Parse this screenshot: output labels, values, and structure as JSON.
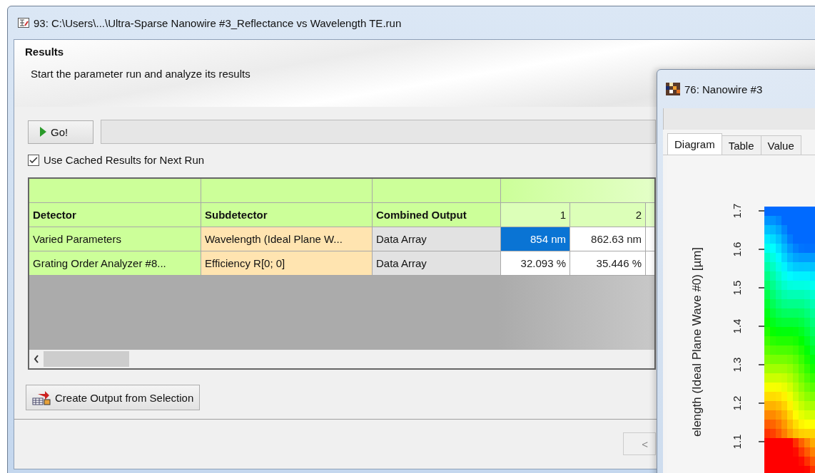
{
  "window": {
    "title": "93: C:\\Users\\...\\Ultra-Sparse Nanowire #3_Reflectance vs Wavelength TE.run"
  },
  "header": {
    "title": "Results",
    "subtitle": "Start the parameter run and analyze its results"
  },
  "go_button": {
    "label": "Go!"
  },
  "cache_checkbox": {
    "label": "Use Cached Results for Next Run",
    "checked": true
  },
  "table": {
    "columns": [
      "Detector",
      "Subdetector",
      "Combined Output",
      "1",
      "2"
    ],
    "rows": [
      {
        "detector": "Varied Parameters",
        "subdetector": "Wavelength (Ideal  Plane W...",
        "output": "Data Array",
        "values": [
          {
            "text": "854 nm",
            "selected": true
          },
          {
            "text": "862.63 nm",
            "selected": false
          }
        ]
      },
      {
        "detector": "Grating Order Analyzer #8...",
        "subdetector": "Efficiency R[0; 0]",
        "output": "Data Array",
        "values": [
          {
            "text": "32.093 %",
            "selected": false
          },
          {
            "text": "35.446 %",
            "selected": false
          }
        ]
      }
    ]
  },
  "create_button": {
    "label": "Create Output from Selection"
  },
  "back_button": {
    "label": "<"
  },
  "child_window": {
    "title": "76: Nanowire #3",
    "tabs": [
      {
        "label": "Diagram",
        "selected": true
      },
      {
        "label": "Table",
        "selected": false
      },
      {
        "label": "Value",
        "selected": false
      }
    ],
    "y_axis": {
      "label": "elength (Ideal Plane Wave #0) [µm]",
      "ticks": [
        "1.7",
        "1.6",
        "1.5",
        "1.4",
        "1.3",
        "1.2",
        "1.1"
      ]
    }
  }
}
